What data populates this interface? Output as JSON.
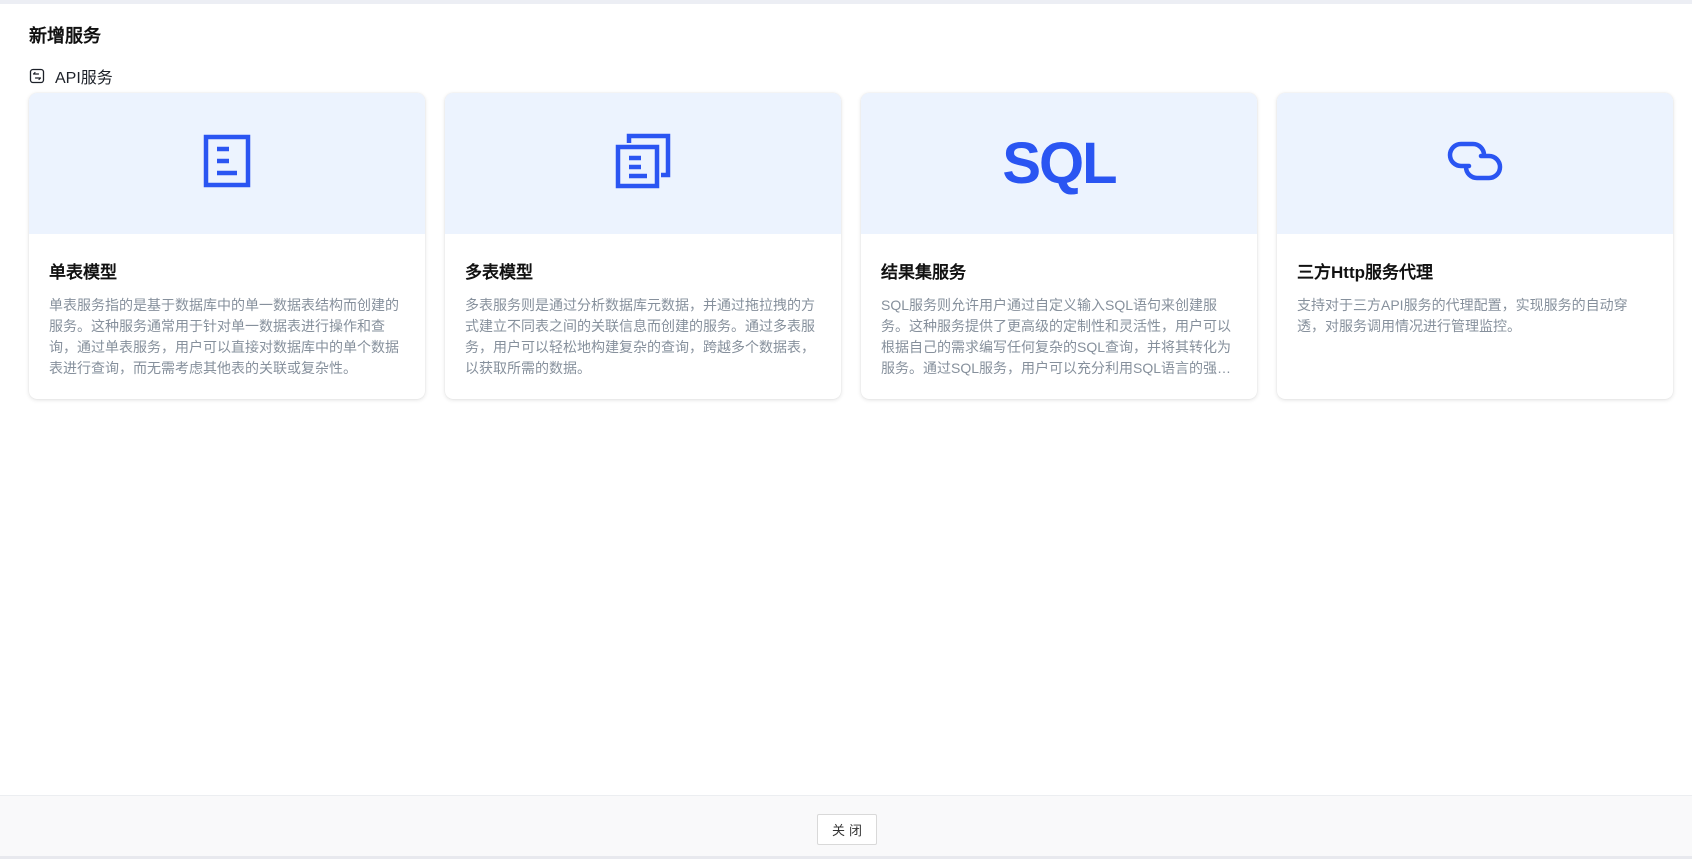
{
  "page": {
    "title": "新增服务"
  },
  "section": {
    "label": "API服务",
    "icon": "api-service-icon"
  },
  "cards": [
    {
      "icon": "document-icon",
      "title": "单表模型",
      "description": "单表服务指的是基于数据库中的单一数据表结构而创建的服务。这种服务通常用于针对单一数据表进行操作和查询，通过单表服务，用户可以直接对数据库中的单个数据表进行查询，而无需考虑其他表的关联或复杂性。"
    },
    {
      "icon": "multi-document-icon",
      "title": "多表模型",
      "description": "多表服务则是通过分析数据库元数据，并通过拖拉拽的方式建立不同表之间的关联信息而创建的服务。通过多表服务，用户可以轻松地构建复杂的查询，跨越多个数据表，以获取所需的数据。"
    },
    {
      "icon": "sql-icon",
      "icon_text": "SQL",
      "title": "结果集服务",
      "description": "SQL服务则允许用户通过自定义输入SQL语句来创建服务。这种服务提供了更高级的定制性和灵活性，用户可以根据自己的需求编写任何复杂的SQL查询，并将其转化为服务。通过SQL服务，用户可以充分利用SQL语言的强大功能，实现各种复杂的数据查询。"
    },
    {
      "icon": "link-icon",
      "title": "三方Http服务代理",
      "description": "支持对于三方API服务的代理配置，实现服务的自动穿透，对服务调用情况进行管理监控。"
    }
  ],
  "footer": {
    "close_label": "关闭"
  },
  "colors": {
    "accent": "#2a55f2",
    "banner": "#ecf3fe",
    "desc_text": "#86909c"
  }
}
